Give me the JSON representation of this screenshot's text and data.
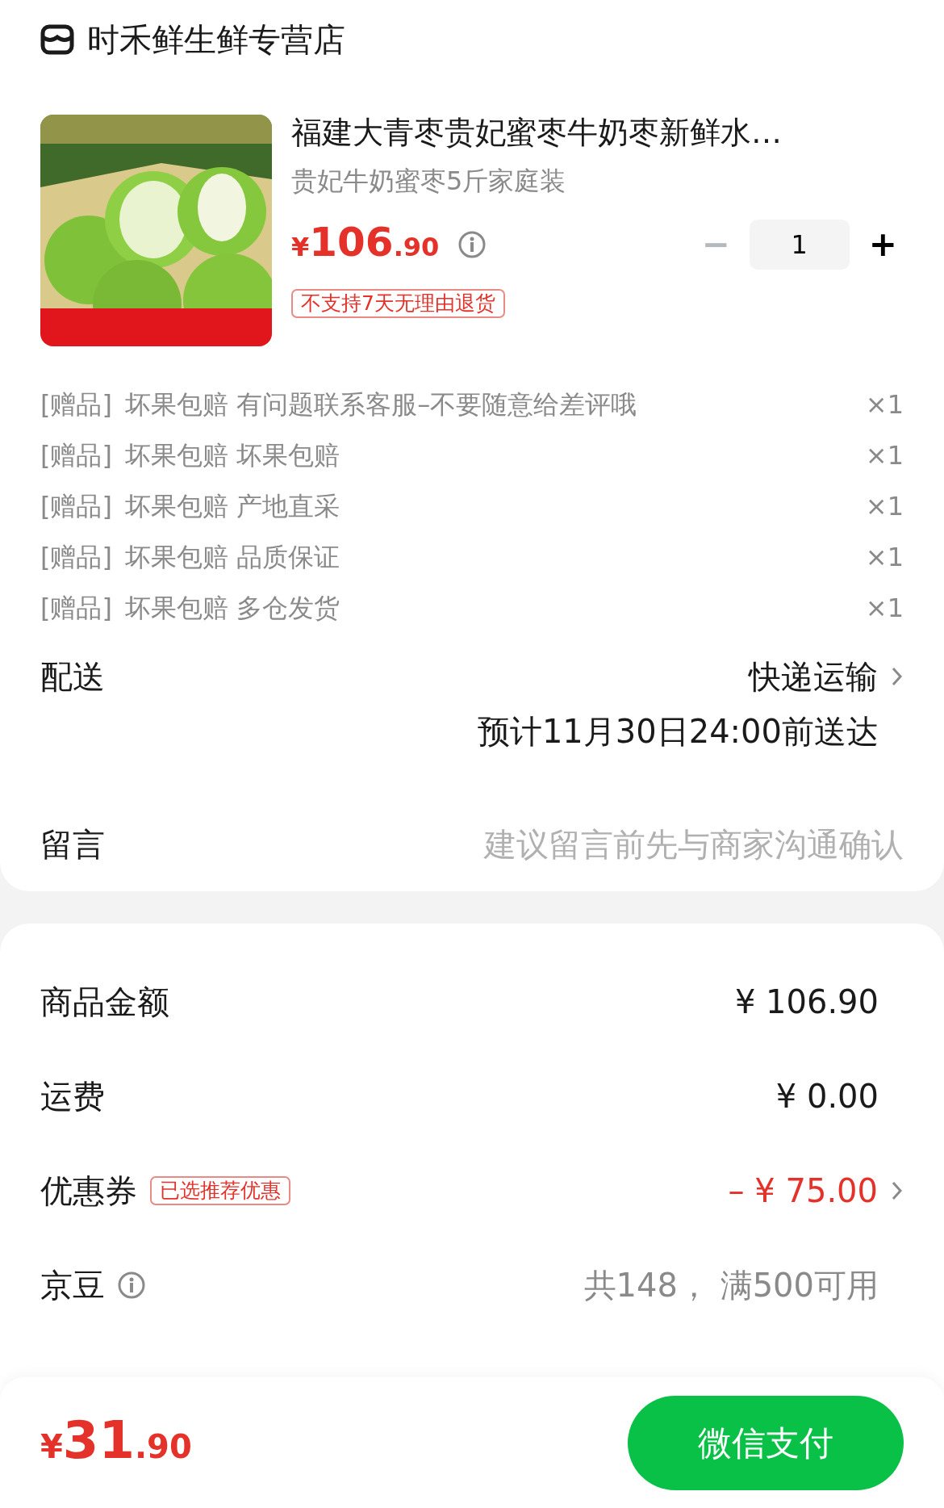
{
  "store": {
    "name": "时禾鲜生鲜专营店"
  },
  "product": {
    "title": "福建大青枣贵妃蜜枣牛奶枣新鲜水…",
    "spec": "贵妃牛奶蜜枣5斤家庭装",
    "price": {
      "currency": "¥",
      "integer": "106",
      "decimal": ".90"
    },
    "quantity": "1",
    "minus": "−",
    "plus": "+",
    "tag": "不支持7天无理由退货"
  },
  "gifts": [
    {
      "prefix": "[赠品]",
      "name": "坏果包赔 有问题联系客服–不要随意给差评哦",
      "count": "×1"
    },
    {
      "prefix": "[赠品]",
      "name": "坏果包赔 坏果包赔",
      "count": "×1"
    },
    {
      "prefix": "[赠品]",
      "name": "坏果包赔 产地直采",
      "count": "×1"
    },
    {
      "prefix": "[赠品]",
      "name": "坏果包赔 品质保证",
      "count": "×1"
    },
    {
      "prefix": "[赠品]",
      "name": "坏果包赔 多仓发货",
      "count": "×1"
    }
  ],
  "delivery": {
    "label": "配送",
    "method": "快递运输",
    "eta": "预计11月30日24:00前送达"
  },
  "message": {
    "label": "留言",
    "placeholder": "建议留言前先与商家沟通确认"
  },
  "summary": [
    {
      "kind": "plain",
      "label": "商品金额",
      "value": "¥ 106.90"
    },
    {
      "kind": "plain",
      "label": "运费",
      "value": "¥ 0.00"
    },
    {
      "kind": "discount",
      "label": "优惠券",
      "tag": "已选推荐优惠",
      "value": "– ¥ 75.00"
    },
    {
      "kind": "info",
      "label": "京豆",
      "value": "共148， 满500可用"
    }
  ],
  "footer": {
    "total": {
      "currency": "¥",
      "integer": "31",
      "decimal": ".90"
    },
    "pay_button": "微信支付"
  }
}
